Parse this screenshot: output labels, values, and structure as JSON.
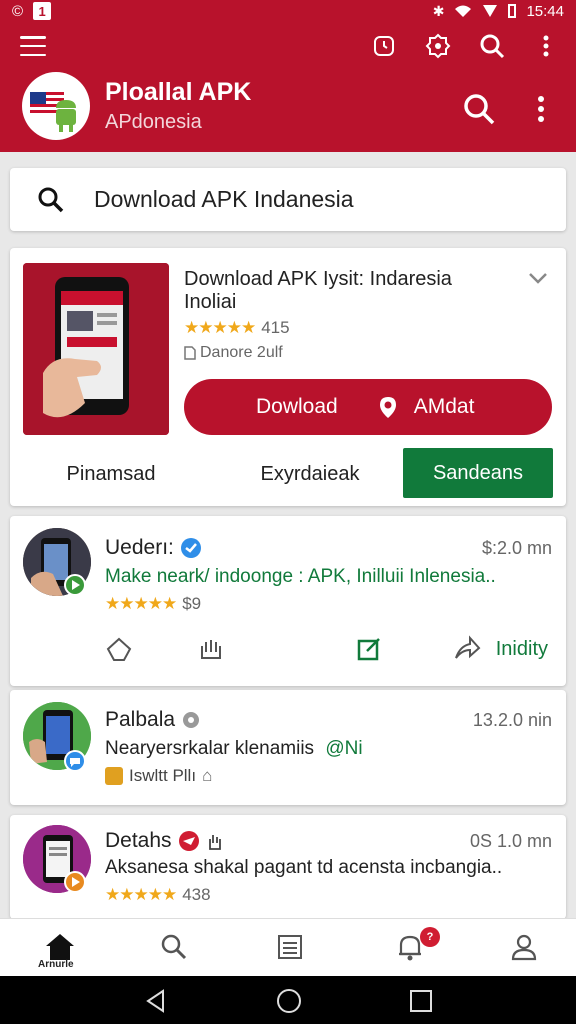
{
  "status_bar": {
    "left_icons": [
      "circle-c-icon",
      "notification-icon"
    ],
    "left_box": "1",
    "time": "15:44",
    "right_icons": [
      "bluetooth-icon",
      "wifi-icon",
      "signal-icon",
      "battery-icon"
    ]
  },
  "app_bar": {
    "title": "Ploallal APK",
    "subtitle": "APdonesia",
    "accent_color": "#b8122c",
    "top_icons": [
      "timer-icon",
      "badge-icon",
      "search-icon",
      "more-vert-icon"
    ]
  },
  "search": {
    "value": "Download APK Indanesia"
  },
  "featured": {
    "title": "Download APK Iysit: Indaresia Inoliai",
    "rating_count": "415",
    "stars": 4.5,
    "size_label": "Danore 2ulf",
    "download_label": "Dowload",
    "secondary_label": "AMdat",
    "tabs": [
      {
        "label": "Pinamsad"
      },
      {
        "label": "Exyrdaieak"
      },
      {
        "label": "Sandeans"
      }
    ]
  },
  "posts": [
    {
      "name": "Uederı:",
      "time": "$:2.0 mn",
      "desc": "Make neark/ indoonge : APK, Inilluii Inlenesia..",
      "rating_text": "$9",
      "stars": 4.5,
      "action_label": "Inidity"
    },
    {
      "name": "Palbala",
      "time": "13.2.0 nin",
      "desc": "Nearyersrkalar klenamiis",
      "desc_badge": "@Ni",
      "meta": "Iswltt Pllı"
    },
    {
      "name": "Detahs",
      "time": "0S 1.0 mn",
      "desc": "Aksanesa shakal pagant td acensta incbangia..",
      "rating_text": "438",
      "stars": 4.5
    }
  ],
  "bottom_nav": {
    "home_label": "Arnurle",
    "notification_count": "?"
  }
}
